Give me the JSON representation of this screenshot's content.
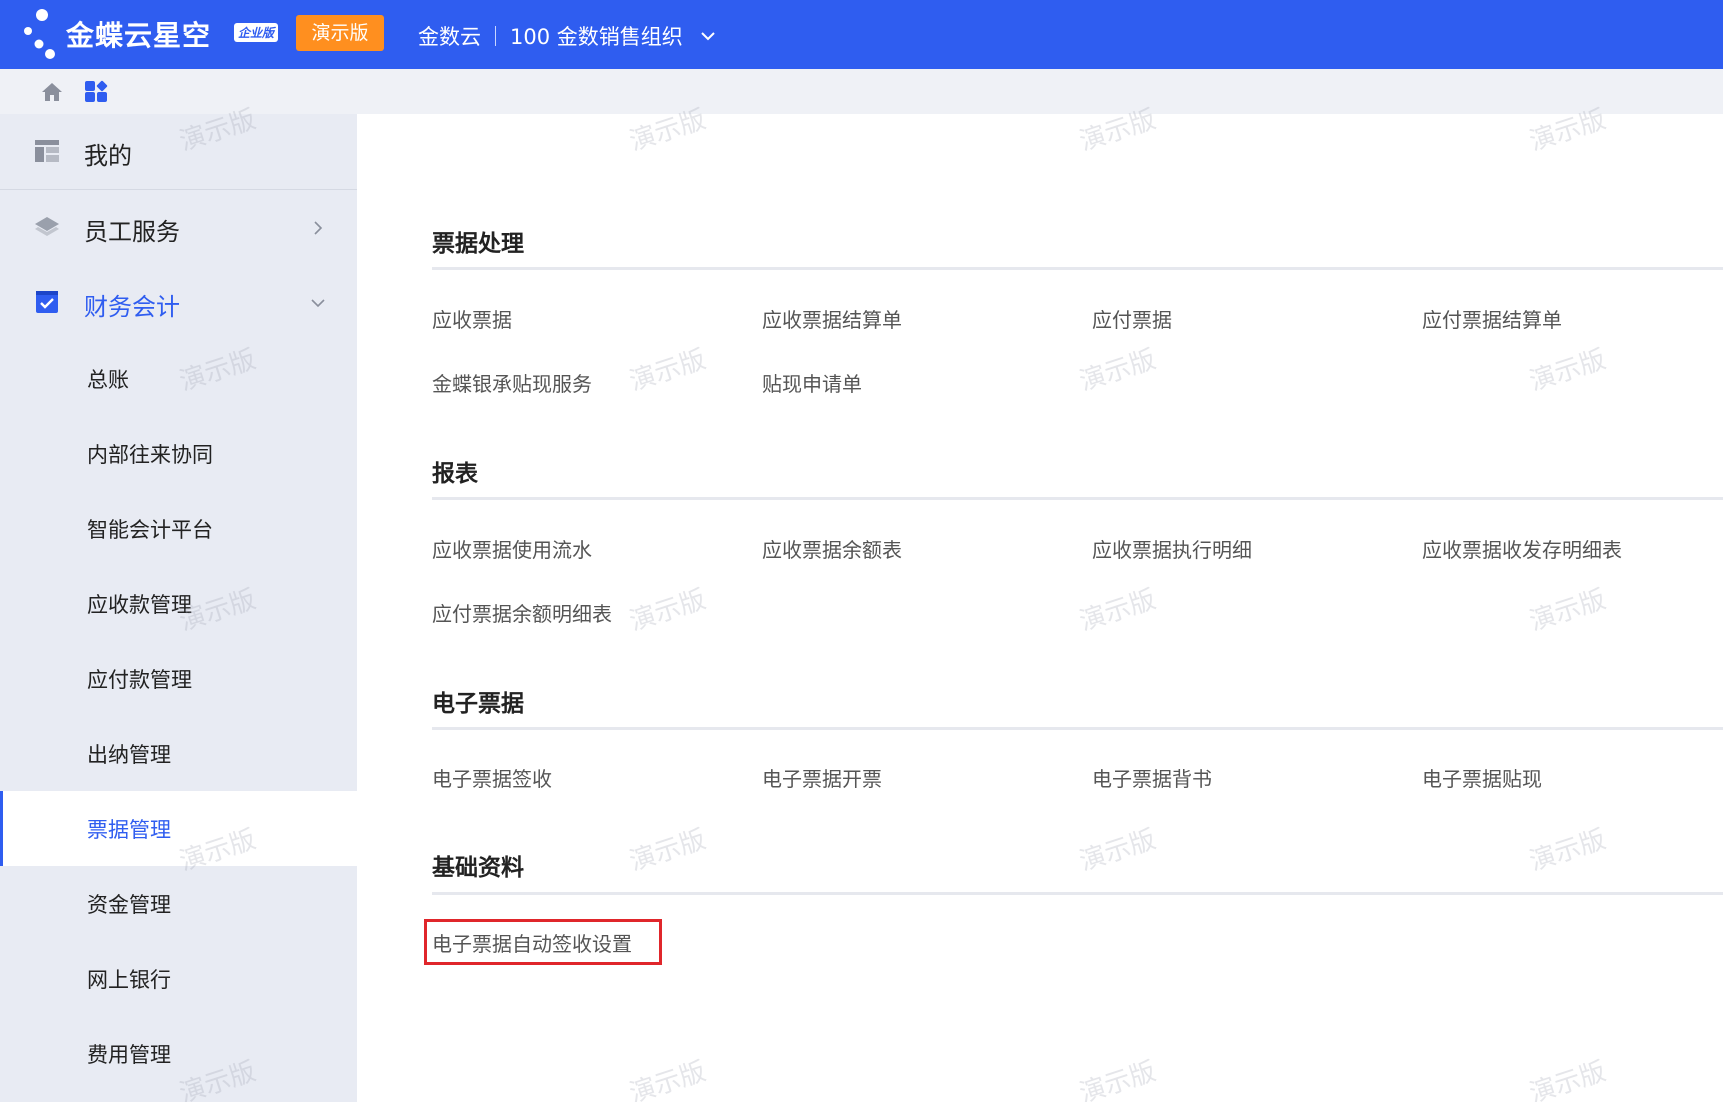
{
  "header": {
    "brand": "金蝶云星空",
    "brand_badge": "企业版",
    "demo_button": "演示版",
    "tenant": "金数云",
    "org": "100 金数销售组织"
  },
  "sidebar": {
    "top_items": [
      {
        "label": "我的",
        "icon": "dashboard-icon"
      },
      {
        "label": "员工服务",
        "icon": "layers-icon"
      },
      {
        "label": "财务会计",
        "icon": "checkbox-icon"
      }
    ],
    "sub_items": [
      {
        "label": "总账"
      },
      {
        "label": "内部往来协同"
      },
      {
        "label": "智能会计平台"
      },
      {
        "label": "应收款管理"
      },
      {
        "label": "应付款管理"
      },
      {
        "label": "出纳管理"
      },
      {
        "label": "票据管理",
        "active": true
      },
      {
        "label": "资金管理"
      },
      {
        "label": "网上银行"
      },
      {
        "label": "费用管理"
      }
    ]
  },
  "main": {
    "sections": [
      {
        "title": "票据处理",
        "links": [
          "应收票据",
          "应收票据结算单",
          "应付票据",
          "应付票据结算单",
          "金蝶银承贴现服务",
          "贴现申请单"
        ]
      },
      {
        "title": "报表",
        "links": [
          "应收票据使用流水",
          "应收票据余额表",
          "应收票据执行明细",
          "应收票据收发存明细表",
          "应付票据余额明细表"
        ]
      },
      {
        "title": "电子票据",
        "links": [
          "电子票据签收",
          "电子票据开票",
          "电子票据背书",
          "电子票据贴现"
        ]
      },
      {
        "title": "基础资料",
        "links": [
          "电子票据自动签收设置"
        ]
      }
    ]
  },
  "watermark": "演示版",
  "colors": {
    "primary": "#2f5df0",
    "demo_orange": "#ff8f1f",
    "highlight_red": "#e0262b"
  }
}
